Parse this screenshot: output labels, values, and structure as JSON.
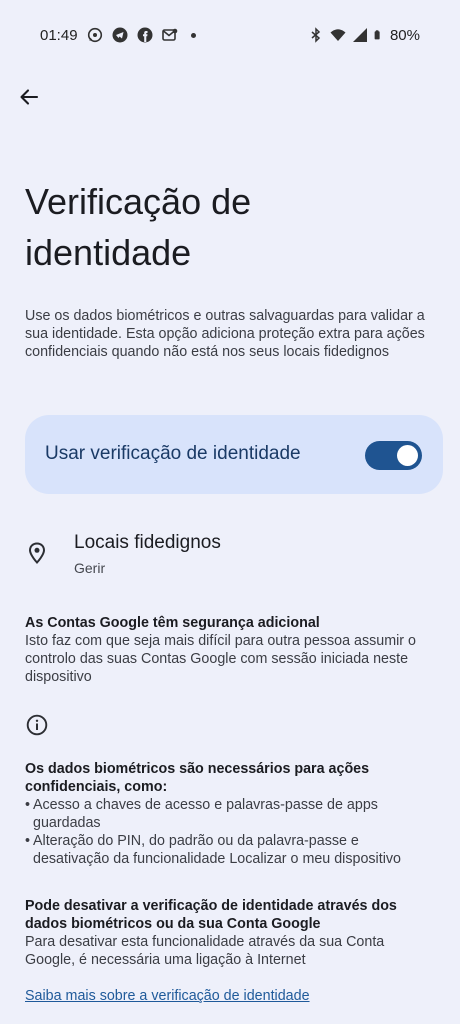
{
  "status_bar": {
    "time": "01:49",
    "battery": "80%",
    "left_icons": [
      "whatsapp-icon",
      "telegram-icon",
      "facebook-icon",
      "message-icon"
    ],
    "right_icons": [
      "bluetooth-icon",
      "wifi-icon",
      "signal-icon",
      "battery-icon"
    ]
  },
  "header": {
    "back_icon": "arrow-back-icon",
    "title": "Verificação de identidade"
  },
  "description": "Use os dados biométricos e outras salvaguardas para validar a sua identidade. Esta opção adiciona proteção extra para ações confidenciais quando não está nos seus locais fidedignos",
  "toggle": {
    "label": "Usar verificação de identidade",
    "enabled": true
  },
  "trusted_places": {
    "icon": "location-pin-icon",
    "title": "Locais fidedignos",
    "subtitle": "Gerir"
  },
  "accounts_section": {
    "heading": "As Contas Google têm segurança adicional",
    "body": "Isto faz com que seja mais difícil para outra pessoa assumir o controlo das suas Contas Google com sessão iniciada neste dispositivo"
  },
  "info_icon": "info-icon",
  "biometric_section": {
    "heading": "Os dados biométricos são necessários para ações confidenciais, como:",
    "bullets": [
      "Acesso a chaves de acesso e palavras-passe de apps guardadas",
      "Alteração do PIN, do padrão ou da palavra-passe e desativação da funcionalidade Localizar o meu dispositivo"
    ]
  },
  "disable_section": {
    "heading": "Pode desativar a verificação de identidade através dos dados biométricos ou da sua Conta Google",
    "body": "Para desativar esta funcionalidade através da sua Conta Google, é necessária uma ligação à Internet"
  },
  "learn_more": "Saiba mais sobre a verificação de identidade"
}
